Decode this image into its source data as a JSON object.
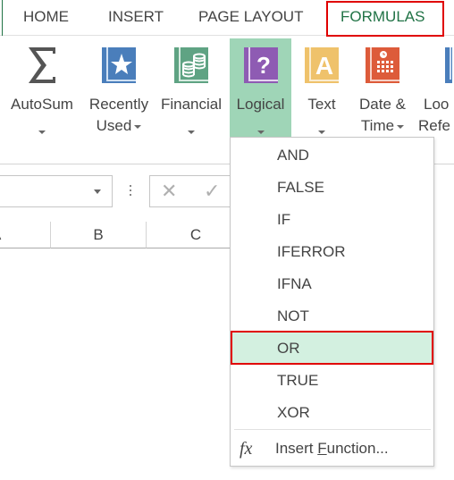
{
  "tabs": [
    {
      "label": "HOME",
      "active": false
    },
    {
      "label": "INSERT",
      "active": false
    },
    {
      "label": "PAGE LAYOUT",
      "active": false
    },
    {
      "label": "FORMULAS",
      "active": true
    }
  ],
  "ribbon": {
    "buttons": [
      {
        "id": "autosum",
        "line1": "AutoSum",
        "line2": "",
        "icon": "sigma-icon"
      },
      {
        "id": "recently-used",
        "line1": "Recently",
        "line2": "Used",
        "icon": "star-book-icon"
      },
      {
        "id": "financial",
        "line1": "Financial",
        "line2": "",
        "icon": "coins-book-icon"
      },
      {
        "id": "logical",
        "line1": "Logical",
        "line2": "",
        "icon": "question-book-icon",
        "selected": true
      },
      {
        "id": "text",
        "line1": "Text",
        "line2": "",
        "icon": "letter-a-book-icon"
      },
      {
        "id": "date-time",
        "line1": "Date &",
        "line2": "Time",
        "icon": "calendar-clock-book-icon"
      },
      {
        "id": "lookup-reference",
        "line1": "Loo",
        "line2": "Refe",
        "icon": "lookup-book-icon"
      }
    ]
  },
  "formula_bar": {
    "name_box_value": "",
    "cancel_icon": "x-icon",
    "enter_icon": "check-icon"
  },
  "columns": [
    "A",
    "B",
    "C"
  ],
  "logical_menu": {
    "items": [
      "AND",
      "FALSE",
      "IF",
      "IFERROR",
      "IFNA",
      "NOT",
      "OR",
      "TRUE",
      "XOR"
    ],
    "highlighted": "OR",
    "insert_function": {
      "prefix": "Insert ",
      "accel": "F",
      "suffix": "unction...",
      "icon": "fx-icon"
    }
  },
  "colors": {
    "accent_green": "#217346",
    "selected_button": "#9fd5b7",
    "hover_item": "#d3f0e0",
    "annotation_red": "#e00000",
    "recent_blue": "#4a7ebb",
    "financial_green": "#5fa383",
    "logical_purple": "#8e5bb3",
    "text_yellow": "#efc26b",
    "date_orange": "#dd5b3a"
  }
}
